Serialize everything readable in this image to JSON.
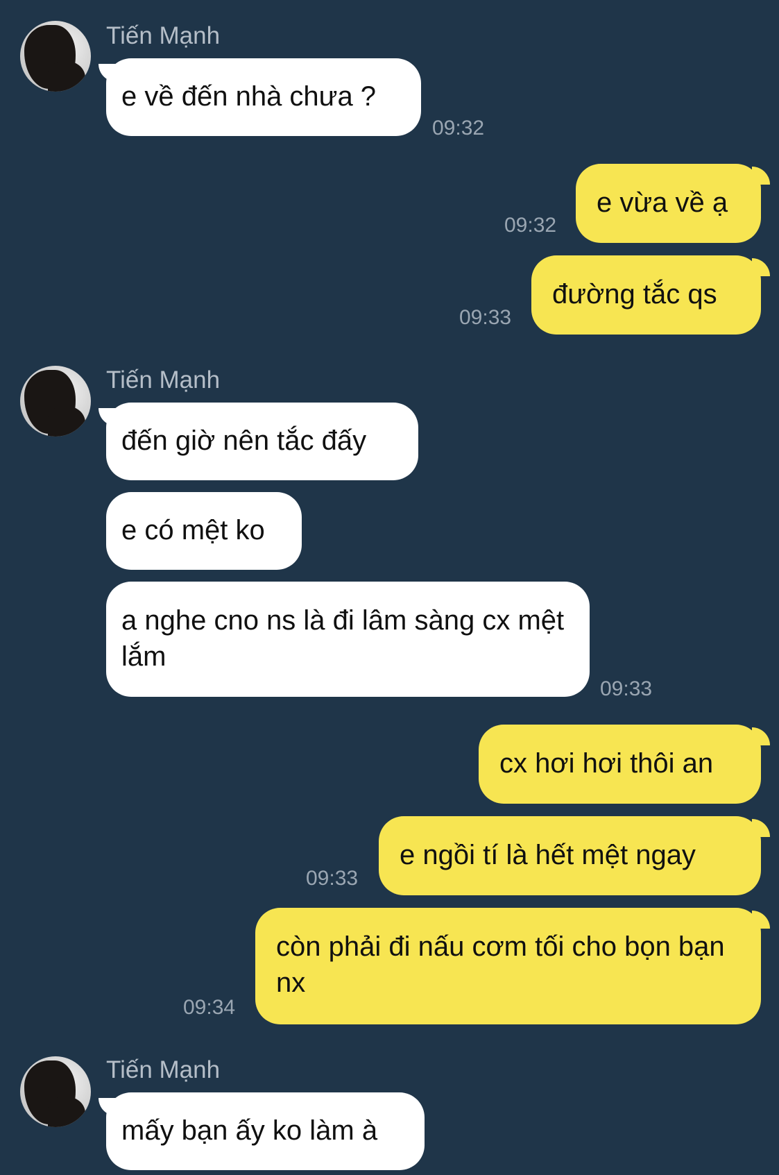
{
  "contact_name": "Tiến Mạnh",
  "messages": [
    {
      "sender": "Tiến Mạnh",
      "text": "e về đến nhà chưa ?",
      "time": "09:32"
    },
    {
      "sender": "me",
      "text": "e vừa về ạ",
      "time": "09:32"
    },
    {
      "sender": "me",
      "text": "đường tắc qs",
      "time": "09:33"
    },
    {
      "sender": "Tiến Mạnh",
      "text": "đến giờ nên tắc đấy"
    },
    {
      "sender": "Tiến Mạnh",
      "text": "e có mệt ko"
    },
    {
      "sender": "Tiến Mạnh",
      "text": "a nghe cno ns là đi lâm sàng cx mệt lắm",
      "time": "09:33"
    },
    {
      "sender": "me",
      "text": "cx hơi hơi thôi an"
    },
    {
      "sender": "me",
      "text": "e ngồi tí là hết mệt ngay",
      "time": "09:33"
    },
    {
      "sender": "me",
      "text": "còn phải đi nấu cơm tối cho bọn bạn nx",
      "time": "09:34"
    },
    {
      "sender": "Tiến Mạnh",
      "text": "mấy bạn ấy ko làm à"
    }
  ],
  "colors": {
    "background": "#1f3549",
    "incoming_bubble": "#ffffff",
    "outgoing_bubble": "#f7e552",
    "timestamp": "#9aa6b2",
    "sender_name": "#b5bec8"
  }
}
